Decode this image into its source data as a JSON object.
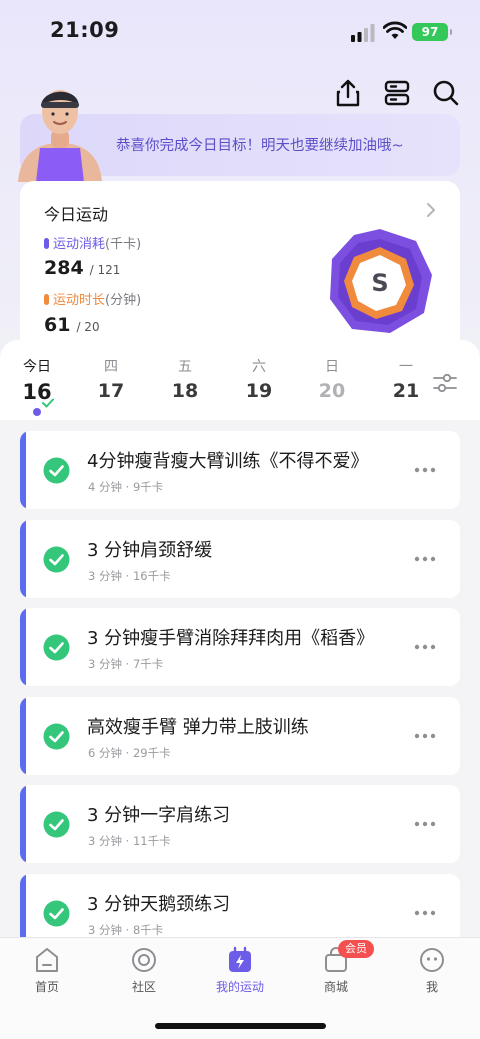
{
  "status": {
    "time": "21:09",
    "battery": "97"
  },
  "banner": {
    "message": "恭喜你完成今日目标！明天也要继续加油哦~"
  },
  "summary": {
    "title": "今日运动",
    "calories": {
      "label": "运动消耗",
      "unit": "(千卡)",
      "value": "284",
      "goal": "/ 121"
    },
    "duration": {
      "label": "运动时长",
      "unit": "(分钟)",
      "value": "61",
      "goal": "/ 20"
    },
    "badge_letter": "S"
  },
  "week": [
    {
      "name": "今日",
      "num": "16",
      "state": "today"
    },
    {
      "name": "四",
      "num": "17",
      "state": "normal"
    },
    {
      "name": "五",
      "num": "18",
      "state": "normal"
    },
    {
      "name": "六",
      "num": "19",
      "state": "normal"
    },
    {
      "name": "日",
      "num": "20",
      "state": "dim"
    },
    {
      "name": "一",
      "num": "21",
      "state": "normal"
    }
  ],
  "tasks": [
    {
      "title": "4分钟瘦背瘦大臂训练《不得不爱》",
      "meta": "4 分钟 · 9千卡",
      "done": true
    },
    {
      "title": "3 分钟肩颈舒缓",
      "meta": "3 分钟 · 16千卡",
      "done": true
    },
    {
      "title": "3 分钟瘦手臂消除拜拜肉用《稻香》",
      "meta": "3 分钟 · 7千卡",
      "done": true
    },
    {
      "title": "高效瘦手臂  弹力带上肢训练",
      "meta": "6 分钟 · 29千卡",
      "done": true
    },
    {
      "title": "3 分钟一字肩练习",
      "meta": "3 分钟 · 11千卡",
      "done": true
    },
    {
      "title": "3 分钟天鹅颈练习",
      "meta": "3 分钟 · 8千卡",
      "done": true
    }
  ],
  "tabs": [
    {
      "label": "首页",
      "icon": "home-icon",
      "active": false
    },
    {
      "label": "社区",
      "icon": "community-icon",
      "active": false
    },
    {
      "label": "我的运动",
      "icon": "my-sports-icon",
      "active": true
    },
    {
      "label": "商城",
      "icon": "shop-icon",
      "active": false
    },
    {
      "label": "我",
      "icon": "profile-icon",
      "active": false
    }
  ],
  "shop_badge": "会员",
  "colors": {
    "accent": "#6c5ce7",
    "calories": "#6c5ce7",
    "duration": "#f08a3c",
    "done": "#34c77b",
    "bar": "#5b6cf0"
  }
}
